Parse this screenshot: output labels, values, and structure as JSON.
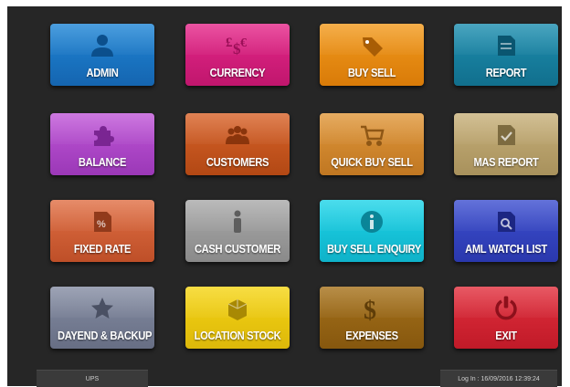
{
  "tiles": [
    {
      "label": "ADMIN",
      "icon": "user-icon",
      "color": "#1f86d6",
      "dark": "#1565b0",
      "glyph": "#0b4f8c"
    },
    {
      "label": "CURRENCY",
      "icon": "currency-icon",
      "color": "#e5288a",
      "dark": "#c0166d",
      "glyph": "#9b0f57"
    },
    {
      "label": "BUY SELL",
      "icon": "tag-icon",
      "color": "#f29a1e",
      "dark": "#d97b08",
      "glyph": "#a85d05"
    },
    {
      "label": "REPORT",
      "icon": "document-icon",
      "color": "#1d8fb0",
      "dark": "#116f8d",
      "glyph": "#0a5670"
    },
    {
      "label": "BALANCE",
      "icon": "puzzle-icon",
      "color": "#c057d8",
      "dark": "#9b38b7",
      "glyph": "#7a2592"
    },
    {
      "label": "CUSTOMERS",
      "icon": "group-icon",
      "color": "#d8632a",
      "dark": "#b24814",
      "glyph": "#8a350c"
    },
    {
      "label": "QUICK BUY SELL",
      "icon": "cart-icon",
      "color": "#e0973a",
      "dark": "#c07722",
      "glyph": "#8f5715"
    },
    {
      "label": "MAS REPORT",
      "icon": "checked-document-icon",
      "color": "#c7b07a",
      "dark": "#a8915c",
      "glyph": "#7d6b40"
    },
    {
      "label": "FIXED RATE",
      "icon": "percent-document-icon",
      "color": "#e06f44",
      "dark": "#be4f28",
      "glyph": "#913a1b"
    },
    {
      "label": "CASH CUSTOMER",
      "icon": "person-icon",
      "color": "#a9a9a9",
      "dark": "#8a8a8a",
      "glyph": "#5e5e5e"
    },
    {
      "label": "BUY SELL ENQUIRY",
      "icon": "info-icon",
      "color": "#1ed4e8",
      "dark": "#0fb2c9",
      "glyph": "#0a8598"
    },
    {
      "label": "AML WATCH LIST",
      "icon": "search-document-icon",
      "color": "#3d4fd0",
      "dark": "#2a38ad",
      "glyph": "#1c2682"
    },
    {
      "label": "DAYEND & BACKUP",
      "icon": "star-icon",
      "color": "#858da3",
      "dark": "#676e84",
      "glyph": "#4a5063"
    },
    {
      "label": "LOCATION STOCK",
      "icon": "box-icon",
      "color": "#f5d515",
      "dark": "#ddb80a",
      "glyph": "#a88904"
    },
    {
      "label": "EXPENSES",
      "icon": "dollar-icon",
      "color": "#a6721b",
      "dark": "#86570e",
      "glyph": "#5f3d08"
    },
    {
      "label": "EXIT",
      "icon": "power-icon",
      "color": "#e2303e",
      "dark": "#c01a28",
      "glyph": "#8c101b"
    }
  ],
  "status": {
    "left": "UPS",
    "right": "Log In : 16/09/2016 12:39:24"
  }
}
